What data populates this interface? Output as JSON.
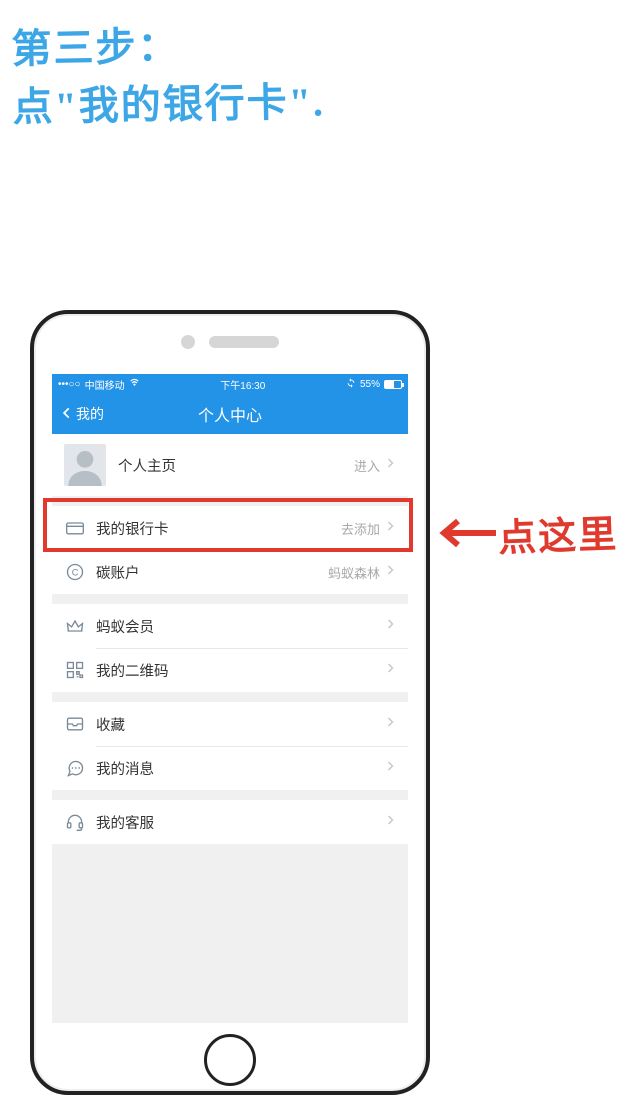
{
  "annotation": {
    "step_line1": "第三步：",
    "step_line2": "点\"我的银行卡\".",
    "pointer_label": "点这里"
  },
  "statusbar": {
    "carrier": "中国移动",
    "time": "下午16:30",
    "battery_text": "55%",
    "signal_dots": "•••○○"
  },
  "navbar": {
    "back_label": "我的",
    "title": "个人中心"
  },
  "rows": {
    "profile": {
      "label": "个人主页",
      "detail": "进入"
    },
    "bankcard": {
      "label": "我的银行卡",
      "detail": "去添加"
    },
    "carbon": {
      "label": "碳账户",
      "detail": "蚂蚁森林"
    },
    "member": {
      "label": "蚂蚁会员",
      "detail": ""
    },
    "qrcode": {
      "label": "我的二维码",
      "detail": ""
    },
    "favorite": {
      "label": "收藏",
      "detail": ""
    },
    "message": {
      "label": "我的消息",
      "detail": ""
    },
    "service": {
      "label": "我的客服",
      "detail": ""
    }
  }
}
